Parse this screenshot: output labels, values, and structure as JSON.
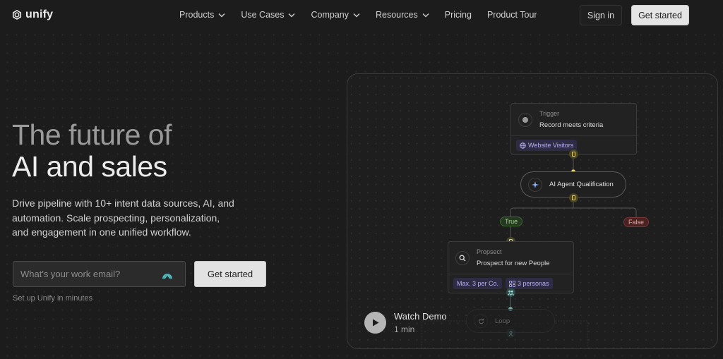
{
  "nav": {
    "logo_text": "unify",
    "menu": [
      {
        "label": "Products",
        "has_dropdown": true
      },
      {
        "label": "Use Cases",
        "has_dropdown": true
      },
      {
        "label": "Company",
        "has_dropdown": true
      },
      {
        "label": "Resources",
        "has_dropdown": true
      },
      {
        "label": "Pricing",
        "has_dropdown": false
      },
      {
        "label": "Product Tour",
        "has_dropdown": false
      }
    ],
    "sign_in": "Sign in",
    "get_started": "Get started"
  },
  "hero": {
    "headline_line1": "The future of",
    "headline_line2": "AI and sales",
    "subheadline": "Drive pipeline with 10+ intent data sources, AI, and automation. Scale prospecting, personalization, and engagement in one unified workflow.",
    "email_placeholder": "What's your work email?",
    "email_value": "",
    "cta": "Get started",
    "note": "Set up Unify in minutes"
  },
  "workflow": {
    "trigger": {
      "kind": "Trigger",
      "title": "Record meets criteria",
      "tag": "Website Visitors"
    },
    "agent": {
      "title": "AI Agent Qualification"
    },
    "branches": {
      "true_label": "True",
      "false_label": "False"
    },
    "prospect": {
      "kind": "Propsect",
      "title": "Prospect for new People",
      "tags": [
        "Max. 3 per Co.",
        "3 personas"
      ]
    },
    "loop": {
      "title": "Loop"
    }
  },
  "demo": {
    "label": "Watch Demo",
    "duration": "1 min"
  },
  "colors": {
    "background": "#1c1c1c",
    "accent_teal": "#4fb3b8",
    "tag_purple": "#b9b1ee",
    "true_green": "#a8d898",
    "false_red": "#f0a0a0",
    "connector_yellow": "#e8d26a"
  }
}
